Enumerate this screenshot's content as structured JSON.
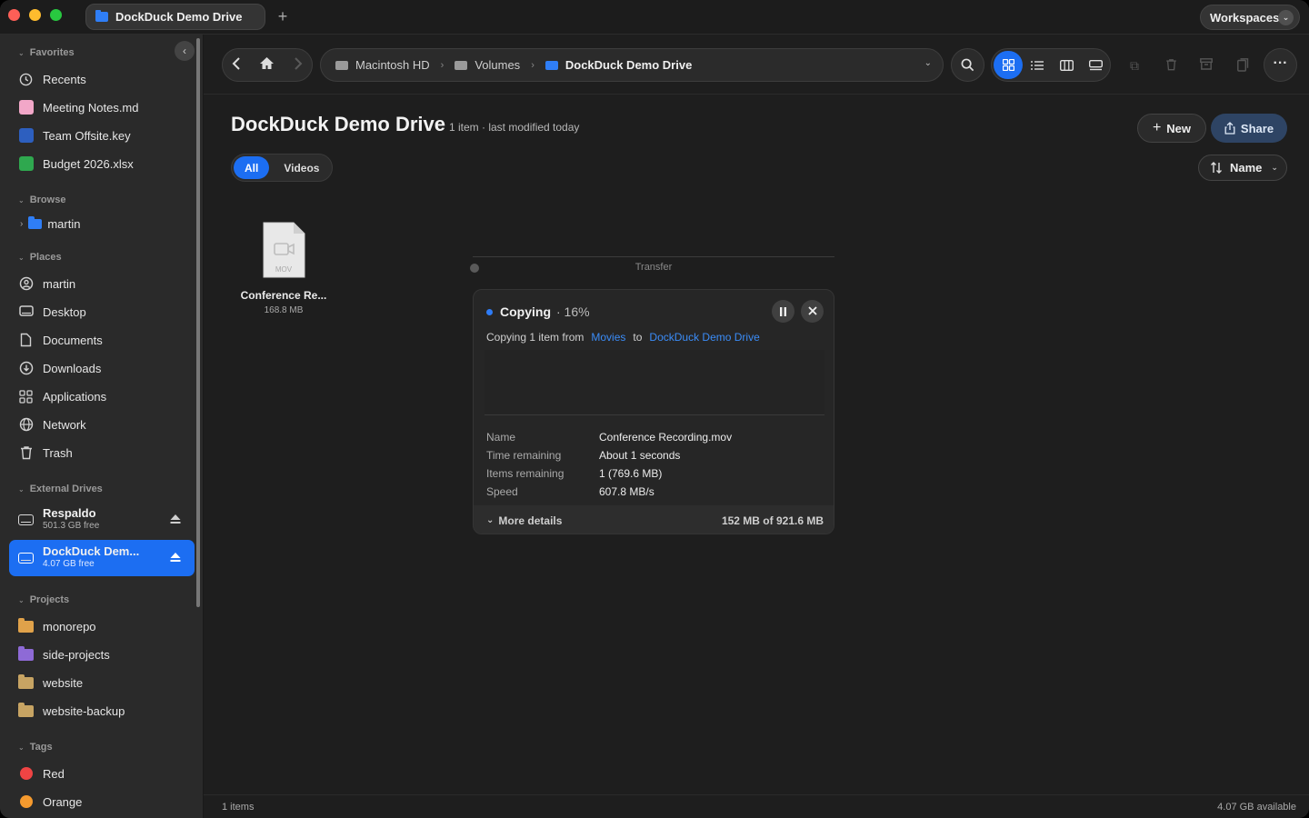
{
  "window": {
    "tab_title": "DockDuck Demo Drive",
    "workspaces_label": "Workspaces"
  },
  "sidebar": {
    "favorites_header": "Favorites",
    "favorites": [
      {
        "label": "Recents",
        "icon": "clock-icon"
      },
      {
        "label": "Meeting Notes.md",
        "icon": "markdown-file-icon",
        "color": "#f2a7c8"
      },
      {
        "label": "Team Offsite.key",
        "icon": "keynote-file-icon",
        "color": "#2d5fbf"
      },
      {
        "label": "Budget 2026.xlsx",
        "icon": "spreadsheet-file-icon",
        "color": "#2fa84f"
      }
    ],
    "browse_header": "Browse",
    "browse": [
      {
        "label": "martin",
        "icon": "folder-icon",
        "color": "#2f7ef6"
      }
    ],
    "places_header": "Places",
    "places": [
      {
        "label": "martin",
        "icon": "user-icon"
      },
      {
        "label": "Desktop",
        "icon": "desktop-icon"
      },
      {
        "label": "Documents",
        "icon": "document-icon"
      },
      {
        "label": "Downloads",
        "icon": "download-icon"
      },
      {
        "label": "Applications",
        "icon": "apps-grid-icon"
      },
      {
        "label": "Network",
        "icon": "globe-icon"
      },
      {
        "label": "Trash",
        "icon": "trash-icon"
      }
    ],
    "drives_header": "External Drives",
    "drives": [
      {
        "name": "Respaldo",
        "free": "501.3 GB free",
        "active": false
      },
      {
        "name": "DockDuck Dem...",
        "free": "4.07 GB free",
        "active": true
      }
    ],
    "projects_header": "Projects",
    "projects": [
      {
        "label": "monorepo",
        "color": "#e0a24a"
      },
      {
        "label": "side-projects",
        "color": "#8e6ad6"
      },
      {
        "label": "website",
        "color": "#c7a463"
      },
      {
        "label": "website-backup",
        "color": "#c7a463"
      }
    ],
    "tags_header": "Tags",
    "tags": [
      {
        "label": "Red",
        "color": "#ef4444"
      },
      {
        "label": "Orange",
        "color": "#f59a2e"
      }
    ]
  },
  "toolbar": {
    "path": [
      {
        "label": "Macintosh HD",
        "icon": "hdd-icon"
      },
      {
        "label": "Volumes",
        "icon": "folder-icon"
      },
      {
        "label": "DockDuck Demo Drive",
        "icon": "drive-icon"
      }
    ]
  },
  "content": {
    "title": "DockDuck Demo Drive",
    "subtitle": "1 item · last modified today",
    "new_label": "New",
    "share_label": "Share",
    "filter_all": "All",
    "filter_videos": "Videos",
    "sort_label": "Name",
    "file": {
      "name": "Conference Re...",
      "size": "168.8 MB",
      "ext": "MOV"
    }
  },
  "transfer": {
    "label": "Transfer",
    "status": "Copying",
    "percent": "· 16%",
    "progress_fraction": 0.16,
    "desc_prefix": "Copying 1 item from",
    "source": "Movies",
    "to_word": "to",
    "destination": "DockDuck Demo Drive",
    "details": [
      {
        "k": "Name",
        "v": "Conference Recording.mov"
      },
      {
        "k": "Time remaining",
        "v": "About 1 seconds"
      },
      {
        "k": "Items remaining",
        "v": "1 (769.6 MB)"
      },
      {
        "k": "Speed",
        "v": "607.8 MB/s"
      }
    ],
    "more_details": "More details",
    "amount": "152 MB of 921.6 MB"
  },
  "status": {
    "items": "1 items",
    "available": "4.07 GB available"
  },
  "colors": {
    "accent": "#1c6ef2",
    "link": "#3b8cf7"
  }
}
